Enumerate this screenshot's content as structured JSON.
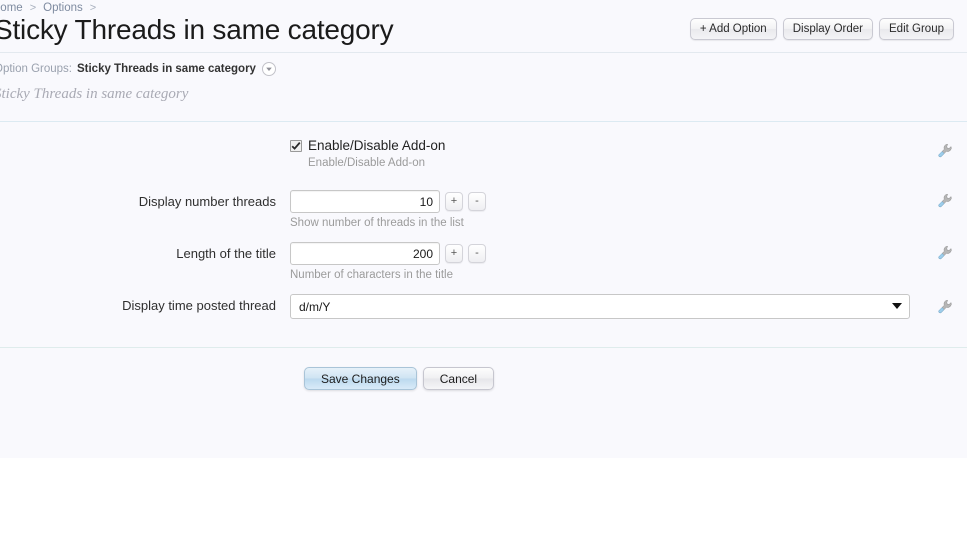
{
  "breadcrumb": {
    "items": [
      {
        "label": "Home",
        "separator": ">"
      },
      {
        "label": "Options",
        "separator": ">"
      }
    ]
  },
  "header": {
    "title": "Sticky Threads in same category",
    "actions": [
      {
        "label": "+ Add Option",
        "name": "add-option-button"
      },
      {
        "label": "Display Order",
        "name": "display-order-button"
      },
      {
        "label": "Edit Group",
        "name": "edit-group-button"
      }
    ]
  },
  "option_groups": {
    "label": "Option Groups:",
    "value": "Sticky Threads in same category",
    "chevron_icon": "chevron-down-icon"
  },
  "subtitle": "Sticky Threads in same category",
  "form": {
    "rows": [
      {
        "type": "checkbox",
        "label": "",
        "checkbox_label": "Enable/Disable Add-on",
        "checked": true,
        "hint": "Enable/Disable Add-on",
        "tool_icon": "wrench-icon"
      },
      {
        "type": "number",
        "label": "Display number threads",
        "value": "10",
        "hint": "Show number of threads in the list",
        "increment_label": "+",
        "decrement_label": "-",
        "tool_icon": "wrench-icon"
      },
      {
        "type": "number",
        "label": "Length of the title",
        "value": "200",
        "hint": "Number of characters in the title",
        "increment_label": "+",
        "decrement_label": "-",
        "tool_icon": "wrench-icon"
      },
      {
        "type": "select",
        "label": "Display time posted thread",
        "value": "d/m/Y",
        "options": [
          "d/m/Y"
        ],
        "hint": "",
        "tool_icon": "wrench-icon"
      }
    ]
  },
  "footer": {
    "save_label": "Save Changes",
    "cancel_label": "Cancel"
  },
  "colors": {
    "canvas_bg": "#f9f9fd",
    "rule": "#dceaf2",
    "primary_button": "#cfe4f3",
    "muted_text": "#9b9b9b",
    "wrench_handle": "#9ecdea",
    "wrench_head": "#b6b6b6"
  }
}
